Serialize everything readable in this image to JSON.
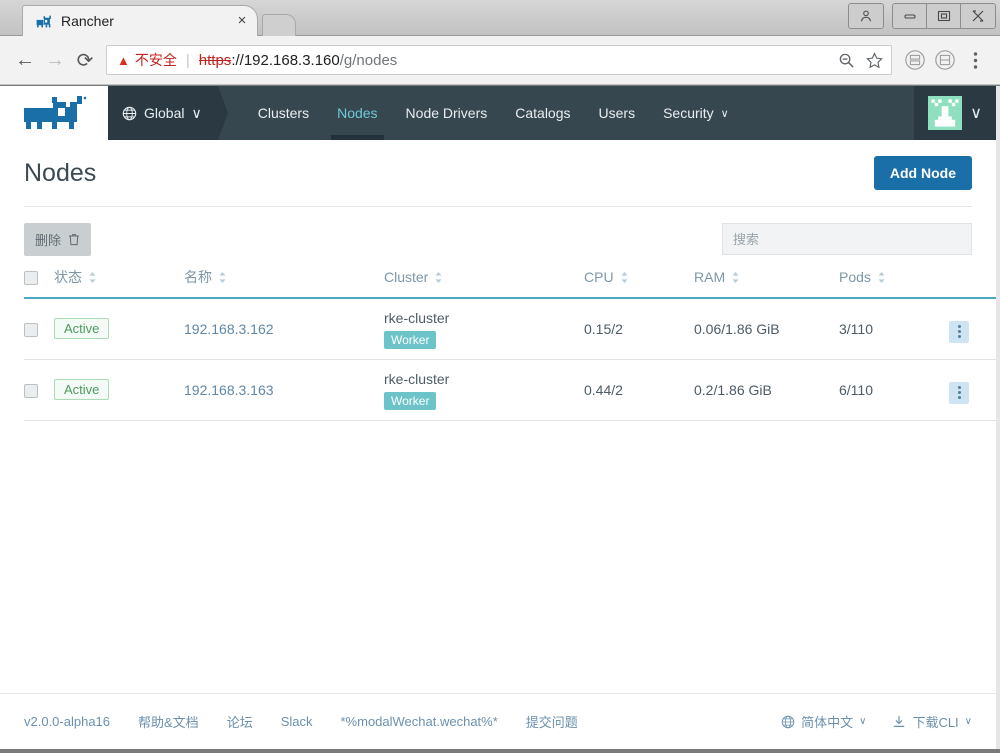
{
  "window": {
    "tab": {
      "title": "Rancher",
      "favicon": "rancher-cow-icon",
      "close": "×"
    },
    "controls": {
      "profile": "profile-icon",
      "minimize": "minimize-icon",
      "maximize": "maximize-icon",
      "close": "close-icon"
    }
  },
  "omnibox": {
    "back": "←",
    "forward": "→",
    "reload": "⟳",
    "security_warning": "不安全",
    "warning_icon": "warning-triangle-icon",
    "url_scheme": "https",
    "url_rest": "://192.168.3.160",
    "url_path": "/g/nodes",
    "zoom_icon": "zoom-out-icon",
    "bookmark_icon": "star-icon",
    "extension_1": "extension-icon",
    "extension_2": "extension-icon",
    "menu_icon": "chrome-menu-icon"
  },
  "header": {
    "logo": "rancher-cow-logo",
    "scope": {
      "icon": "globe-icon",
      "label": "Global",
      "caret": "∨"
    },
    "nav": [
      {
        "label": "Clusters",
        "active": false,
        "caret": ""
      },
      {
        "label": "Nodes",
        "active": true,
        "caret": ""
      },
      {
        "label": "Node Drivers",
        "active": false,
        "caret": ""
      },
      {
        "label": "Catalogs",
        "active": false,
        "caret": ""
      },
      {
        "label": "Users",
        "active": false,
        "caret": ""
      },
      {
        "label": "Security",
        "active": false,
        "caret": "∨"
      }
    ],
    "user": {
      "avatar": "user-identicon-avatar",
      "caret": "∨"
    }
  },
  "main": {
    "page_title": "Nodes",
    "add_button": "Add Node",
    "delete_button": {
      "label": "删除",
      "icon": "trash-icon"
    },
    "search_placeholder": "搜索",
    "search_value": "",
    "columns": [
      {
        "key": "check",
        "label": "",
        "sortable": false
      },
      {
        "key": "state",
        "label": "状态",
        "sortable": true
      },
      {
        "key": "name",
        "label": "名称",
        "sortable": true
      },
      {
        "key": "cluster",
        "label": "Cluster",
        "sortable": true
      },
      {
        "key": "cpu",
        "label": "CPU",
        "sortable": true
      },
      {
        "key": "ram",
        "label": "RAM",
        "sortable": true
      },
      {
        "key": "pods",
        "label": "Pods",
        "sortable": true
      },
      {
        "key": "actions",
        "label": "",
        "sortable": false
      }
    ],
    "rows": [
      {
        "state": "Active",
        "name": "192.168.3.162",
        "cluster": "rke-cluster",
        "role": "Worker",
        "cpu": "0.15/2",
        "ram": "0.06/1.86 GiB",
        "pods": "3/110",
        "menu": "row-actions-icon"
      },
      {
        "state": "Active",
        "name": "192.168.3.163",
        "cluster": "rke-cluster",
        "role": "Worker",
        "cpu": "0.44/2",
        "ram": "0.2/1.86 GiB",
        "pods": "6/110",
        "menu": "row-actions-icon"
      }
    ]
  },
  "footer": {
    "links": [
      "v2.0.0-alpha16",
      "帮助&文档",
      "论坛",
      "Slack",
      "*%modalWechat.wechat%*",
      "提交问题"
    ],
    "language": {
      "icon": "globe-icon",
      "label": "简体中文",
      "caret": "∨"
    },
    "cli": {
      "icon": "download-icon",
      "label": "下载CLI",
      "caret": "∨"
    }
  },
  "colors": {
    "rancher_blue": "#1a6fa8",
    "nav_dark": "#37474f",
    "nav_scope": "#2b3a42",
    "active_teal": "#6ec9d8",
    "role_badge": "#6cc4c9",
    "state_green": "#4c9a5d",
    "header_rule": "#4aa8c0",
    "link_blue": "#5e87a8"
  }
}
